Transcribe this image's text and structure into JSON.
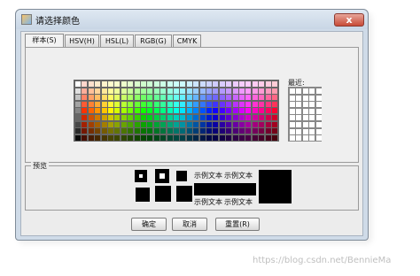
{
  "window": {
    "title": "请选择颜色",
    "close_glyph": "x"
  },
  "tabs": [
    {
      "label": "样本(S)",
      "active": true
    },
    {
      "label": "HSV(H)",
      "active": false
    },
    {
      "label": "HSL(L)",
      "active": false
    },
    {
      "label": "RGB(G)",
      "active": false
    },
    {
      "label": "CMYK",
      "active": false
    }
  ],
  "swatches": {
    "recent_label": "最近:"
  },
  "preview": {
    "label": "预览",
    "sample_text": "示例文本"
  },
  "buttons": {
    "ok": "确定",
    "cancel": "取消",
    "reset": "重置(R)"
  },
  "watermark": "https://blog.csdn.net/BennieMa"
}
